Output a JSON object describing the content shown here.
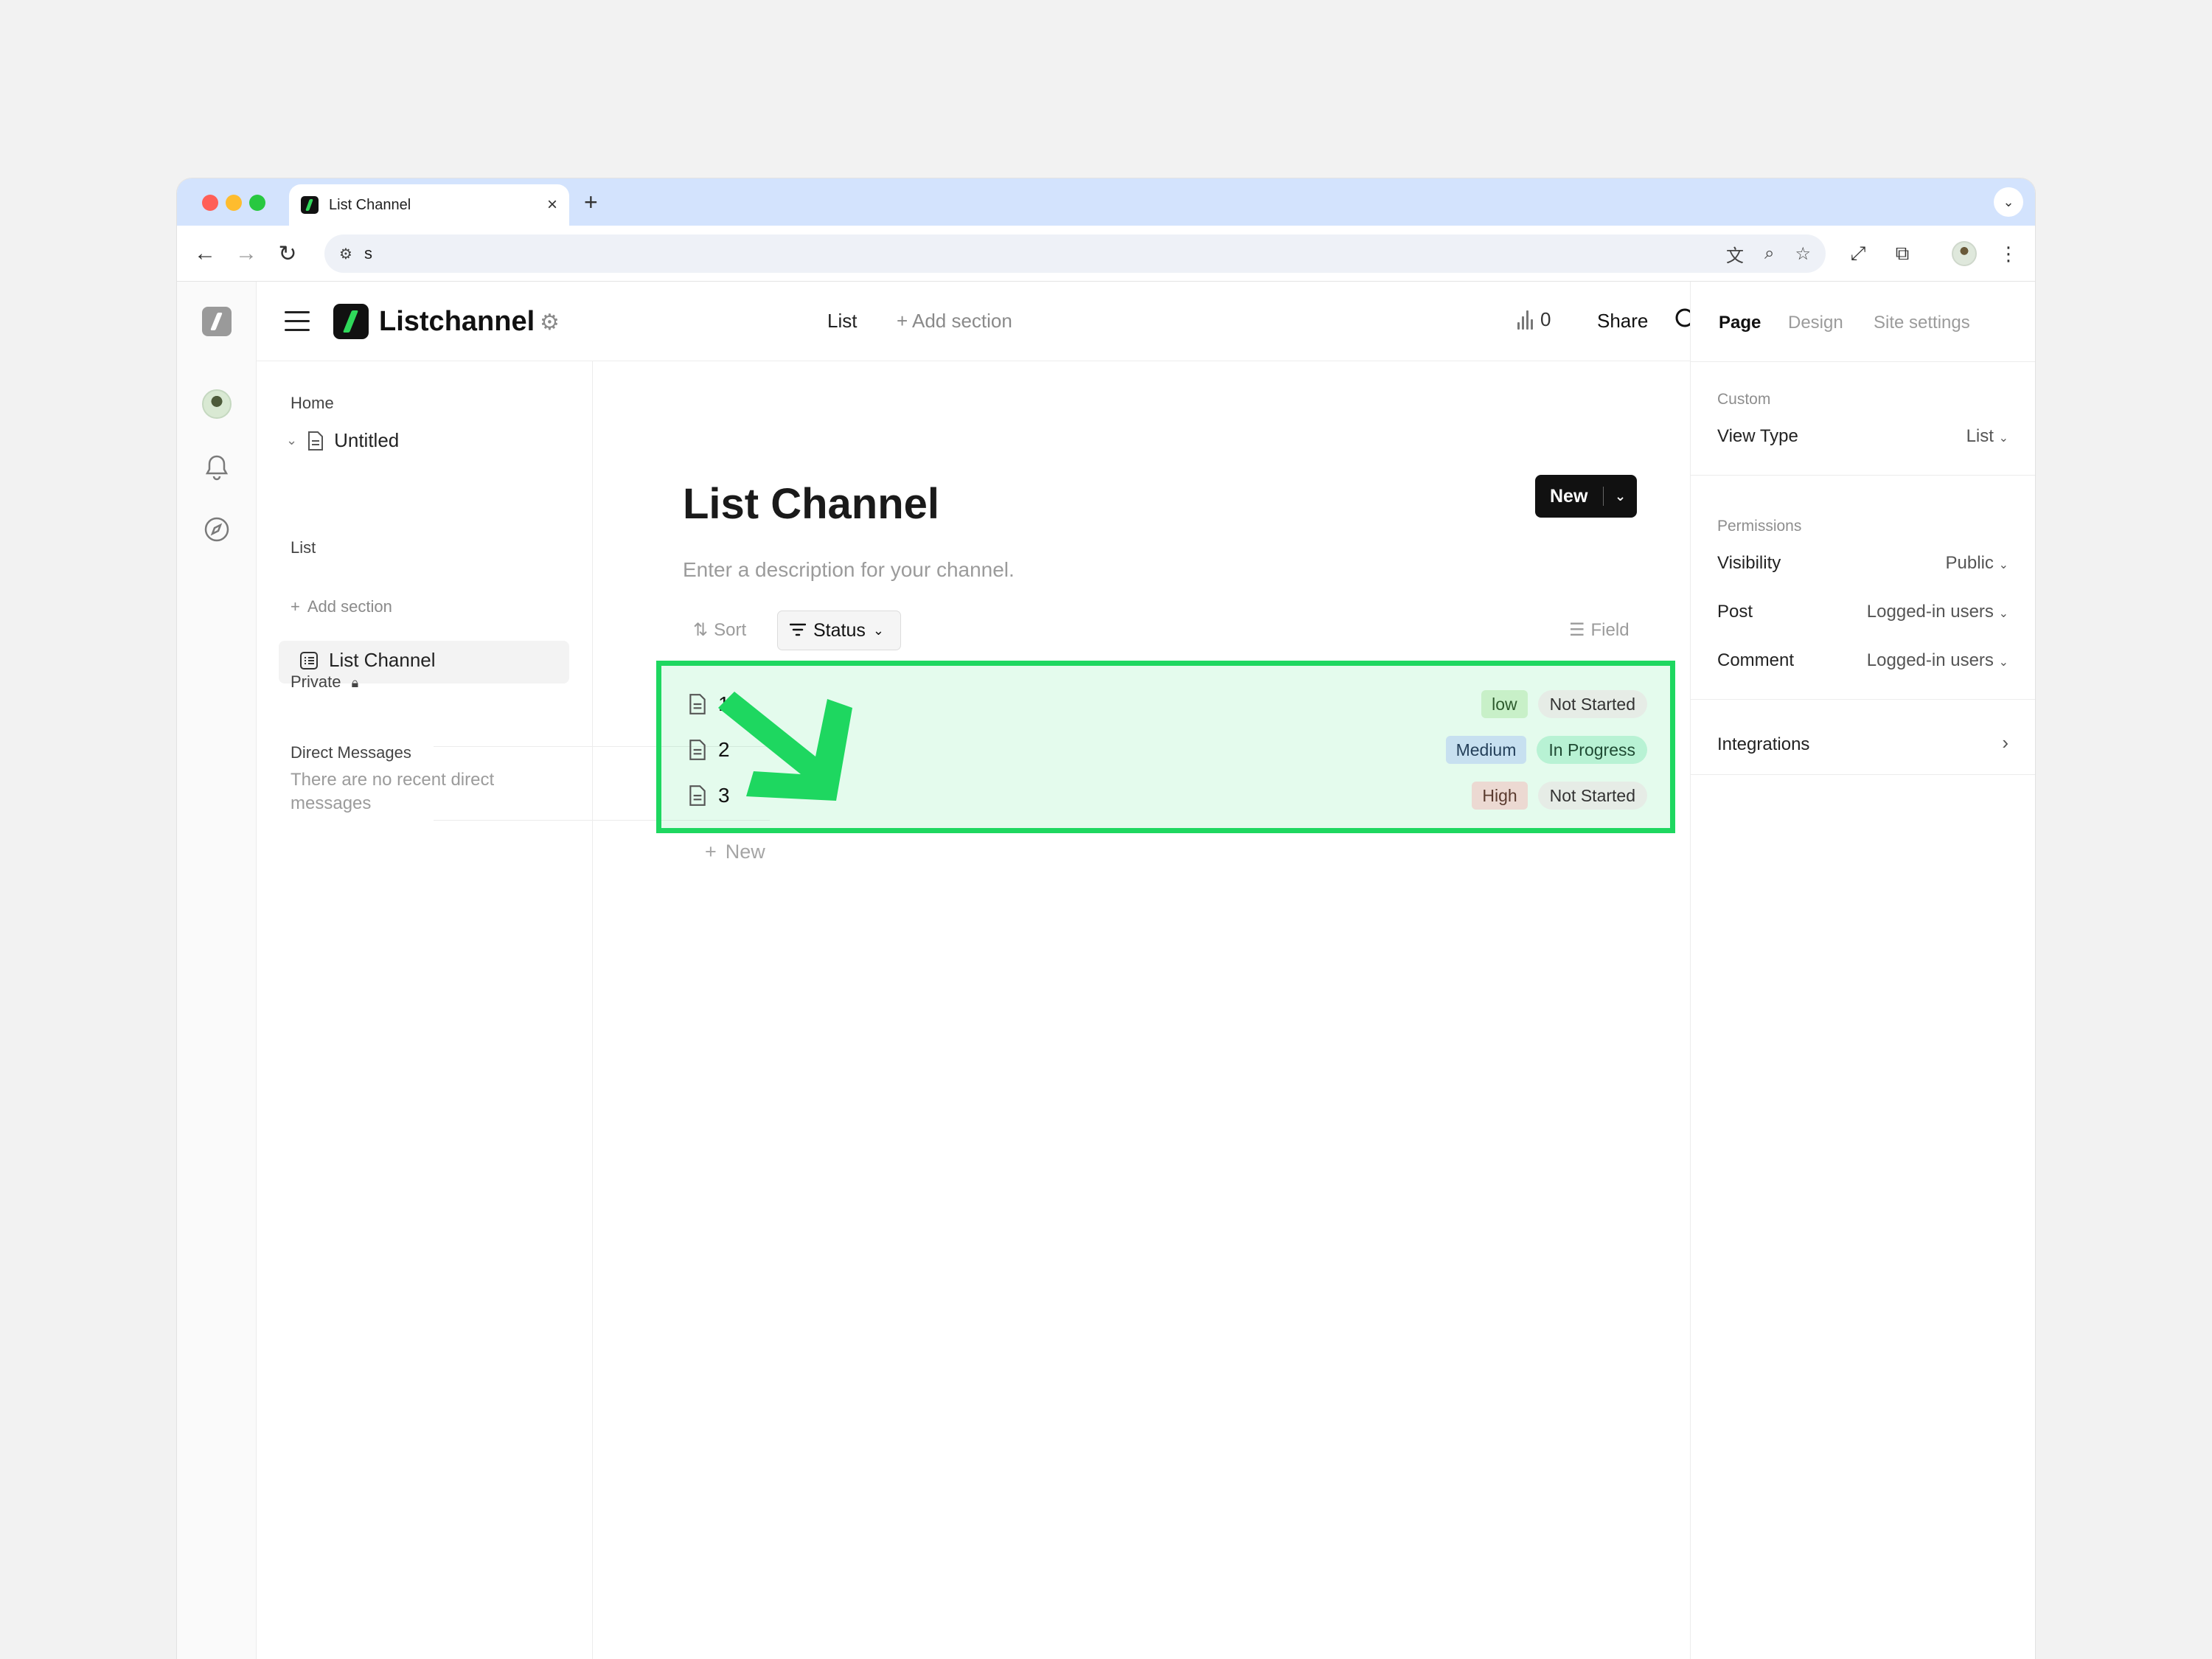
{
  "browser": {
    "tab_title": "List Channel",
    "address": "s"
  },
  "header": {
    "brand": "Listchannel",
    "nav_list": "List",
    "add_section": "+ Add section",
    "stats_count": "0",
    "share": "Share"
  },
  "sidebar": {
    "home": "Home",
    "untitled": "Untitled",
    "list_channel": "List Channel",
    "list_section": "List",
    "add_section": "Add section",
    "private": "Private",
    "dm_title": "Direct Messages",
    "dm_empty": "There are no recent direct messages"
  },
  "main": {
    "title": "List Channel",
    "description": "Enter a description for your channel.",
    "new_button": "New",
    "sort": "Sort",
    "status_filter": "Status",
    "field": "Field",
    "add_new": "New",
    "rows": [
      {
        "label": "1",
        "priority": "low",
        "status": "Not Started"
      },
      {
        "label": "2",
        "priority": "Medium",
        "status": "In Progress"
      },
      {
        "label": "3",
        "priority": "High",
        "status": "Not Started"
      }
    ]
  },
  "right_panel": {
    "tabs": [
      "Page",
      "Design",
      "Site settings"
    ],
    "custom_section": "Custom",
    "view_type_label": "View Type",
    "view_type_value": "List",
    "permissions_section": "Permissions",
    "visibility_label": "Visibility",
    "visibility_value": "Public",
    "post_label": "Post",
    "post_value": "Logged-in users",
    "comment_label": "Comment",
    "comment_value": "Logged-in users",
    "integrations": "Integrations"
  },
  "colors": {
    "highlight_border": "#1ed760",
    "tag_low": "#c8f0c8",
    "tag_medium": "#c7e0f0",
    "tag_high": "#ecd9d2",
    "tag_not_started": "#e6ece6",
    "tag_in_progress": "#b8f2d4",
    "arrow": "#1ed760"
  },
  "icons": {
    "arrow": "pointer-arrow-icon"
  }
}
